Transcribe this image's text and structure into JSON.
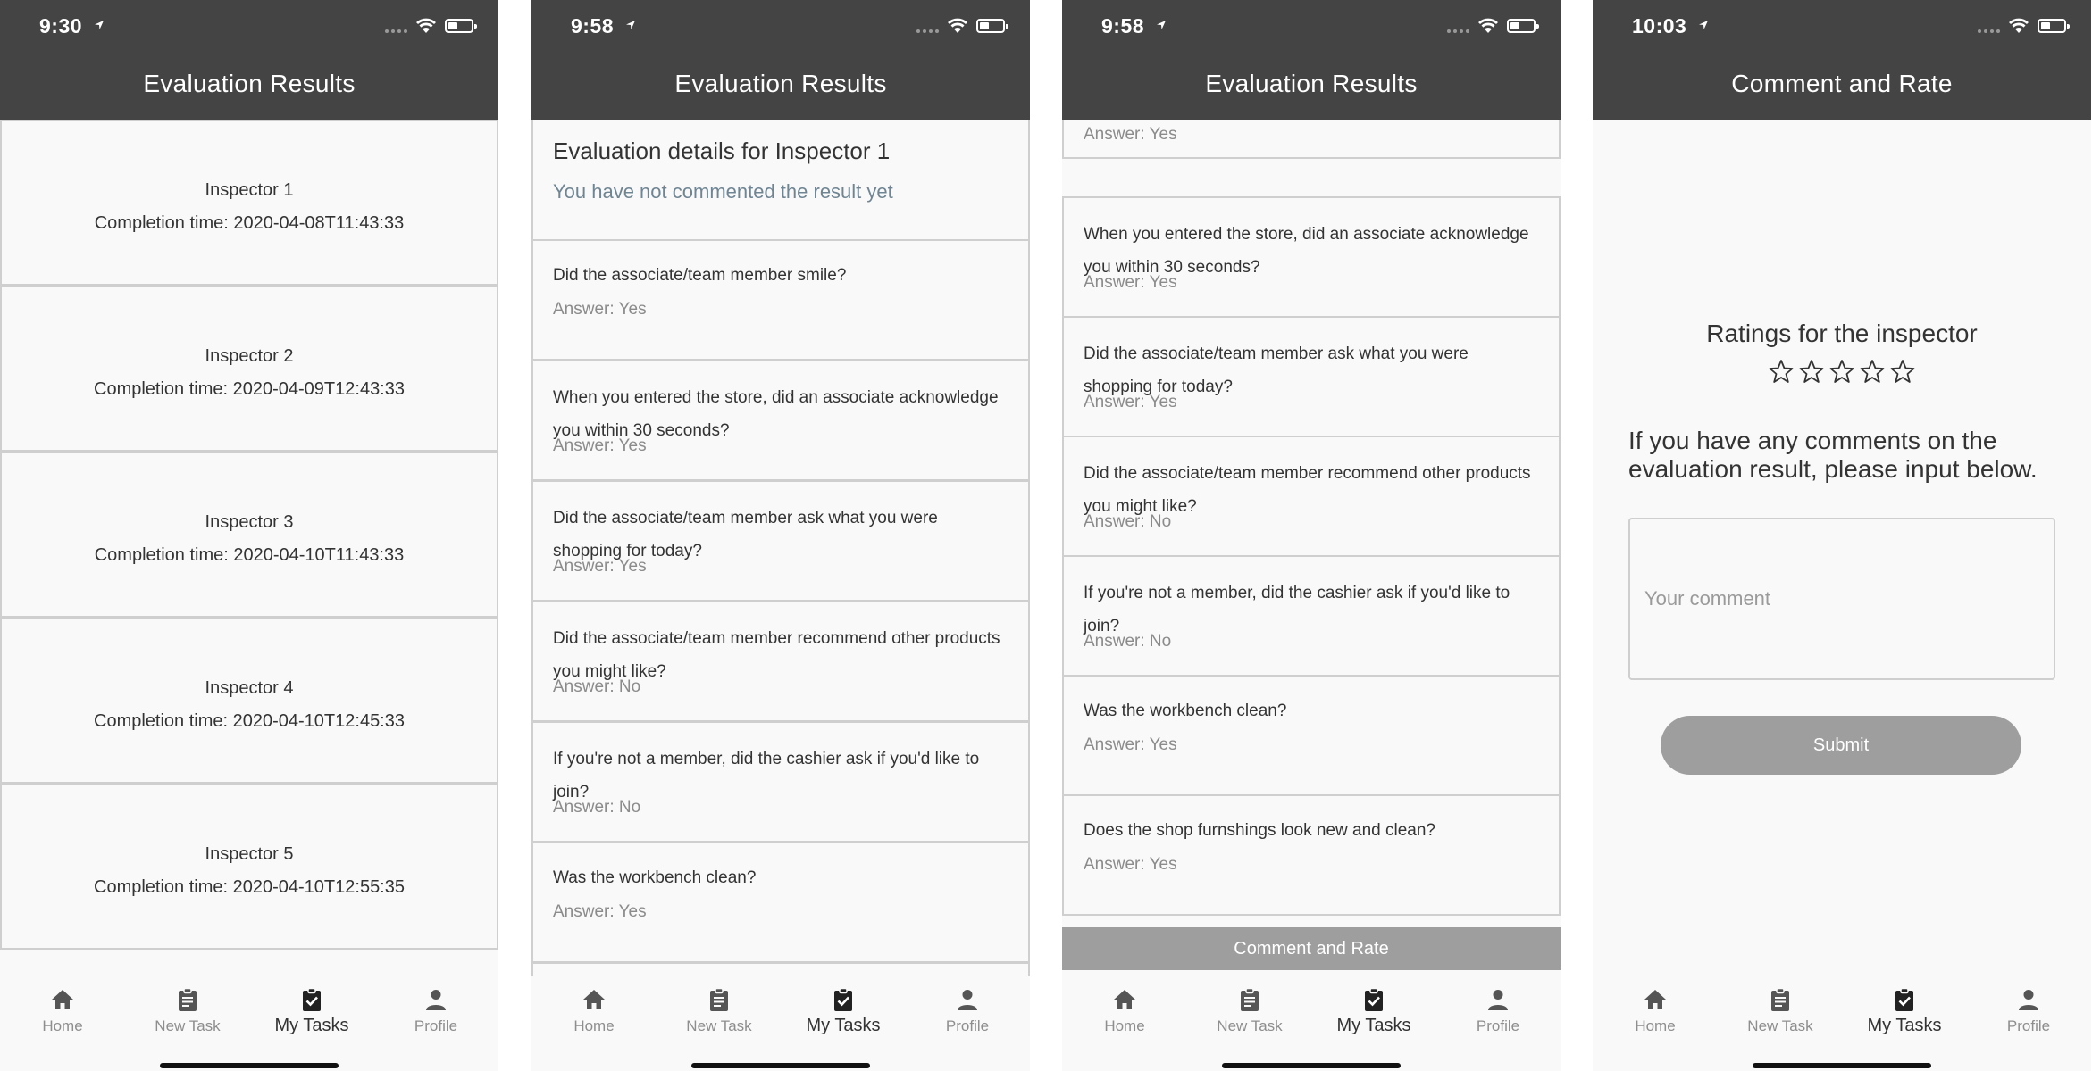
{
  "screens": [
    {
      "time": "9:30",
      "title": "Evaluation Results"
    },
    {
      "time": "9:58",
      "title": "Evaluation Results"
    },
    {
      "time": "9:58",
      "title": "Evaluation Results"
    },
    {
      "time": "10:03",
      "title": "Comment and Rate"
    }
  ],
  "inspectors": [
    {
      "name": "Inspector 1",
      "completion": "Completion time: 2020-04-08T11:43:33"
    },
    {
      "name": "Inspector 2",
      "completion": "Completion time: 2020-04-09T12:43:33"
    },
    {
      "name": "Inspector 3",
      "completion": "Completion time: 2020-04-10T11:43:33"
    },
    {
      "name": "Inspector 4",
      "completion": "Completion time: 2020-04-10T12:45:33"
    },
    {
      "name": "Inspector 5",
      "completion": "Completion time: 2020-04-10T12:55:35"
    }
  ],
  "details": {
    "title": "Evaluation details for Inspector 1",
    "subtitle": "You have not commented the result yet"
  },
  "questions": [
    {
      "text": "Did the associate/team member smile?",
      "answer": "Answer: Yes"
    },
    {
      "text": "When you entered the store, did an associate acknowledge you within 30 seconds?",
      "answer": "Answer: Yes"
    },
    {
      "text": "Did the associate/team member ask what you were shopping for today?",
      "answer": "Answer: Yes"
    },
    {
      "text": "Did the associate/team member recommend other products you might like?",
      "answer": "Answer: No"
    },
    {
      "text": "If you're not a member, did the cashier ask if you'd like to join?",
      "answer": "Answer: No"
    },
    {
      "text": "Was the workbench clean?",
      "answer": "Answer: Yes"
    },
    {
      "text": "Does the shop furnshings look new and clean?",
      "answer": "Answer: Yes"
    }
  ],
  "comment_rate_button": "Comment and Rate",
  "rate": {
    "title": "Ratings for the inspector",
    "stars_total": 5,
    "stars_selected": 0,
    "comment_label": "If you have any comments on the evaluation result, please input below.",
    "comment_placeholder": "Your comment",
    "submit_label": "Submit"
  },
  "tabs": [
    {
      "label": "Home",
      "icon": "home-icon"
    },
    {
      "label": "New Task",
      "icon": "clipboard-icon"
    },
    {
      "label": "My Tasks",
      "icon": "clipboard-check-icon",
      "active": true
    },
    {
      "label": "Profile",
      "icon": "person-icon"
    }
  ],
  "colors": {
    "header": "#444444",
    "background": "#f9f9f9",
    "muted_button": "#9e9e9e",
    "subtitle": "#6f8593"
  }
}
